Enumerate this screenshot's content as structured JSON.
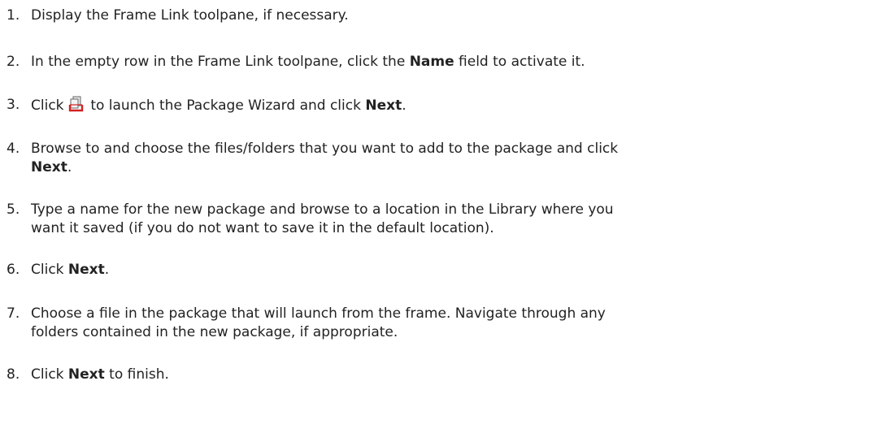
{
  "steps": [
    {
      "num": "1.",
      "text": "Display the Frame Link toolpane, if necessary."
    },
    {
      "num": "2.",
      "pre": "In the empty row in the Frame Link toolpane, click the ",
      "bold": "Name",
      "post": " field to activate it."
    },
    {
      "num": "3.",
      "pre": "Click ",
      "icon": "package-wizard-icon",
      "mid": " to launch the Package Wizard and click ",
      "bold": "Next",
      "post": "."
    },
    {
      "num": "4.",
      "pre": "Browse to and choose the files/folders that you want to add to the package and click",
      "bold": "Next",
      "post": "."
    },
    {
      "num": "5.",
      "line1": "Type a name for the new package and browse to a location in the Library where you",
      "line2": "want it saved (if you do not want to save it in the default location)."
    },
    {
      "num": "6.",
      "pre": "Click ",
      "bold": "Next",
      "post": "."
    },
    {
      "num": "7.",
      "line1": "Choose a file in the package that will launch from the frame. Navigate through any",
      "line2": "folders contained in the new package, if appropriate."
    },
    {
      "num": "8.",
      "pre": "Click ",
      "bold": "Next",
      "post": " to finish."
    }
  ],
  "colors": {
    "text": "#222222",
    "icon_red": "#d32020",
    "icon_doc": "#e8e8e8"
  }
}
